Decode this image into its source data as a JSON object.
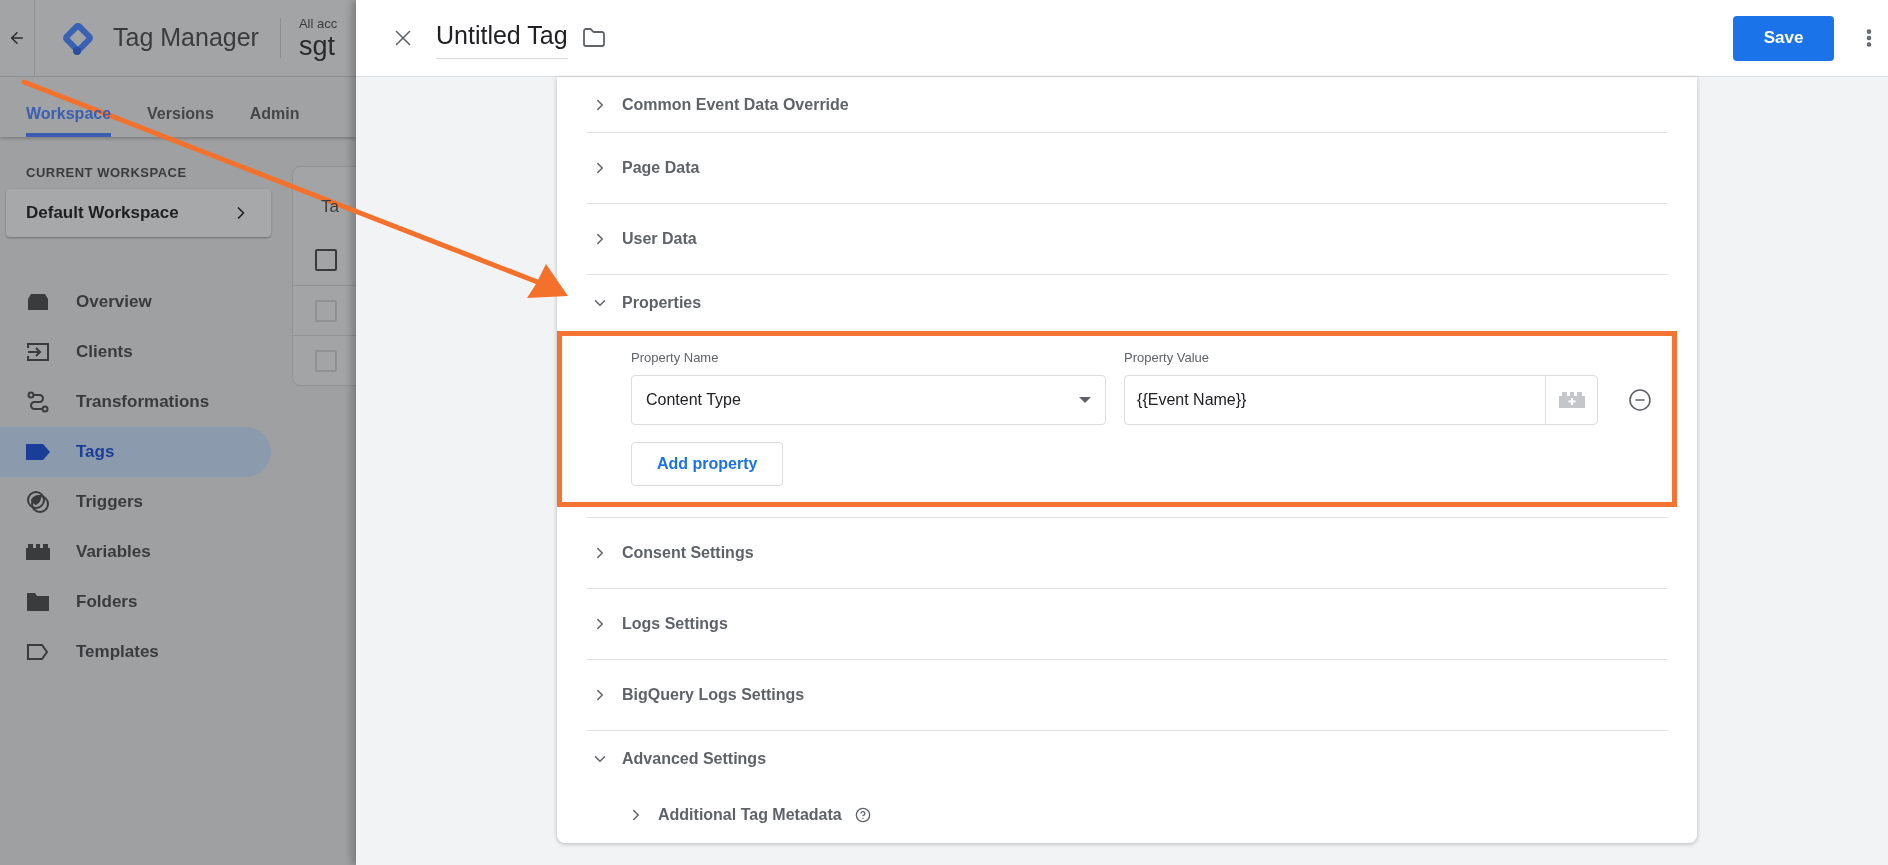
{
  "app": {
    "title": "Tag Manager",
    "account_label": "All acc",
    "container_name": "sgt"
  },
  "nav_tabs": [
    {
      "label": "Workspace",
      "selected": true
    },
    {
      "label": "Versions",
      "selected": false
    },
    {
      "label": "Admin",
      "selected": false
    }
  ],
  "workspace": {
    "heading": "CURRENT WORKSPACE",
    "name": "Default Workspace"
  },
  "sidebar": {
    "items": [
      {
        "label": "Overview",
        "kind": "overview",
        "selected": false
      },
      {
        "label": "Clients",
        "kind": "clients",
        "selected": false
      },
      {
        "label": "Transformations",
        "kind": "transformations",
        "selected": false
      },
      {
        "label": "Tags",
        "kind": "tags",
        "selected": true
      },
      {
        "label": "Triggers",
        "kind": "triggers",
        "selected": false
      },
      {
        "label": "Variables",
        "kind": "variables",
        "selected": false
      },
      {
        "label": "Folders",
        "kind": "folders",
        "selected": false
      },
      {
        "label": "Templates",
        "kind": "templates",
        "selected": false
      }
    ]
  },
  "background_table": {
    "title": "Ta",
    "rows": [
      {
        "checked": false
      },
      {
        "checked": false
      },
      {
        "checked": false
      }
    ]
  },
  "tag_editor": {
    "title": "Untitled Tag",
    "save_label": "Save",
    "sections": [
      {
        "kind": "plain",
        "label": "Common Event Data Override",
        "expanded": false
      },
      {
        "kind": "plain",
        "label": "Page Data",
        "expanded": false
      },
      {
        "kind": "plain",
        "label": "User Data",
        "expanded": false
      },
      {
        "kind": "properties",
        "label": "Properties",
        "expanded": true,
        "highlighted": true,
        "name_label": "Property Name",
        "value_label": "Property Value",
        "rows": [
          {
            "name": "Content Type",
            "value": "{{Event Name}}"
          }
        ],
        "add_label": "Add property"
      },
      {
        "kind": "plain",
        "label": "Consent Settings",
        "expanded": false
      },
      {
        "kind": "plain",
        "label": "Logs Settings",
        "expanded": false
      },
      {
        "kind": "plain",
        "label": "BigQuery Logs Settings",
        "expanded": false
      },
      {
        "kind": "group",
        "label": "Advanced Settings",
        "expanded": true,
        "children": [
          {
            "label": "Additional Tag Metadata",
            "expanded": false,
            "help": true
          }
        ]
      }
    ]
  },
  "annotation_arrow": true
}
